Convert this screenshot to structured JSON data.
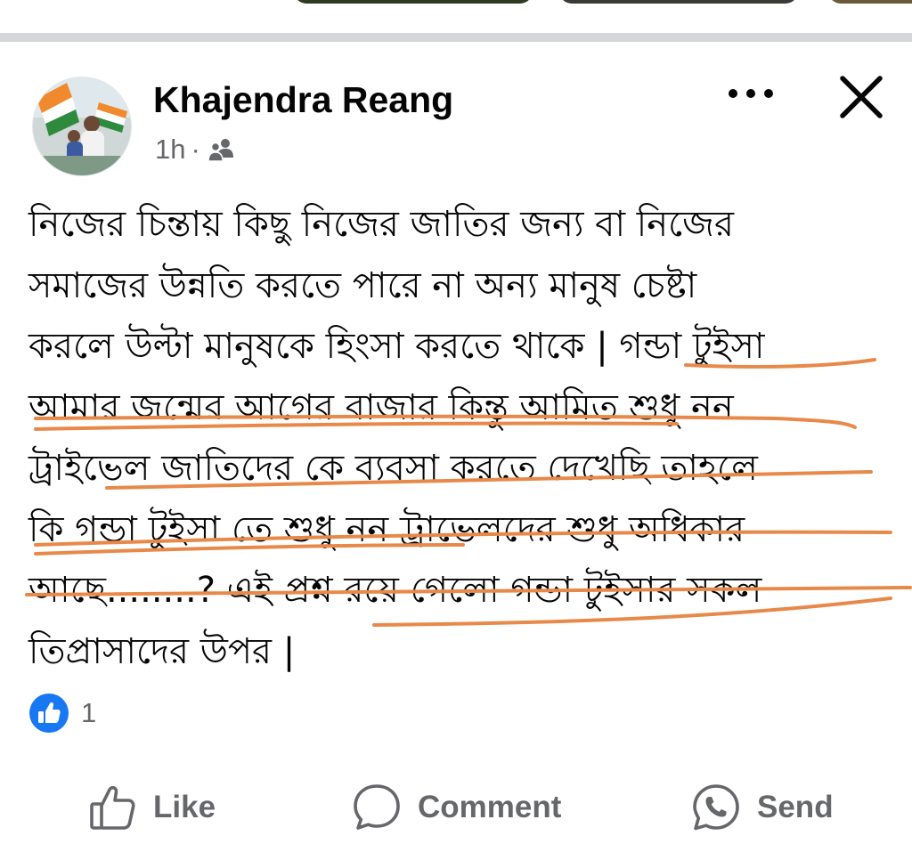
{
  "post": {
    "author": "Khajendra Reang",
    "time": "1h",
    "separator": "·",
    "audience_icon": "friends-icon",
    "text_lines": [
      "নিজের চিন্তায় কিছু নিজের জাতির জন্য বা নিজের",
      "সমাজের উন্নতি করতে পারে না অন্য মানুষ চেষ্টা",
      "করলে উল্টা মানুষকে হিংসা করতে থাকে | গন্ডা টুইসা",
      "আমার জন্মের আগের বাজার কিন্তু আমিত শুধু নন",
      "ট্রাইভেল জাতিদের কে ব্যবসা করতে দেখেছি তাহলে",
      "কি গন্ডা টুইসা তে শুধু নন ট্রাভেলদের শুধু অধিকার",
      "আছে........? এই প্রশ্ন রয়ে গেলো গন্ডা টুইসার সকল",
      "তিপ্রাসাদের উপর |"
    ]
  },
  "reactions": {
    "icon": "like-reaction-icon",
    "count": "1"
  },
  "actions": {
    "like": "Like",
    "comment": "Comment",
    "send": "Send"
  },
  "colors": {
    "highlight": "#e8894a",
    "facebook_blue": "#1877f2",
    "secondary_text": "#65676b",
    "divider": "#d4d6da"
  }
}
